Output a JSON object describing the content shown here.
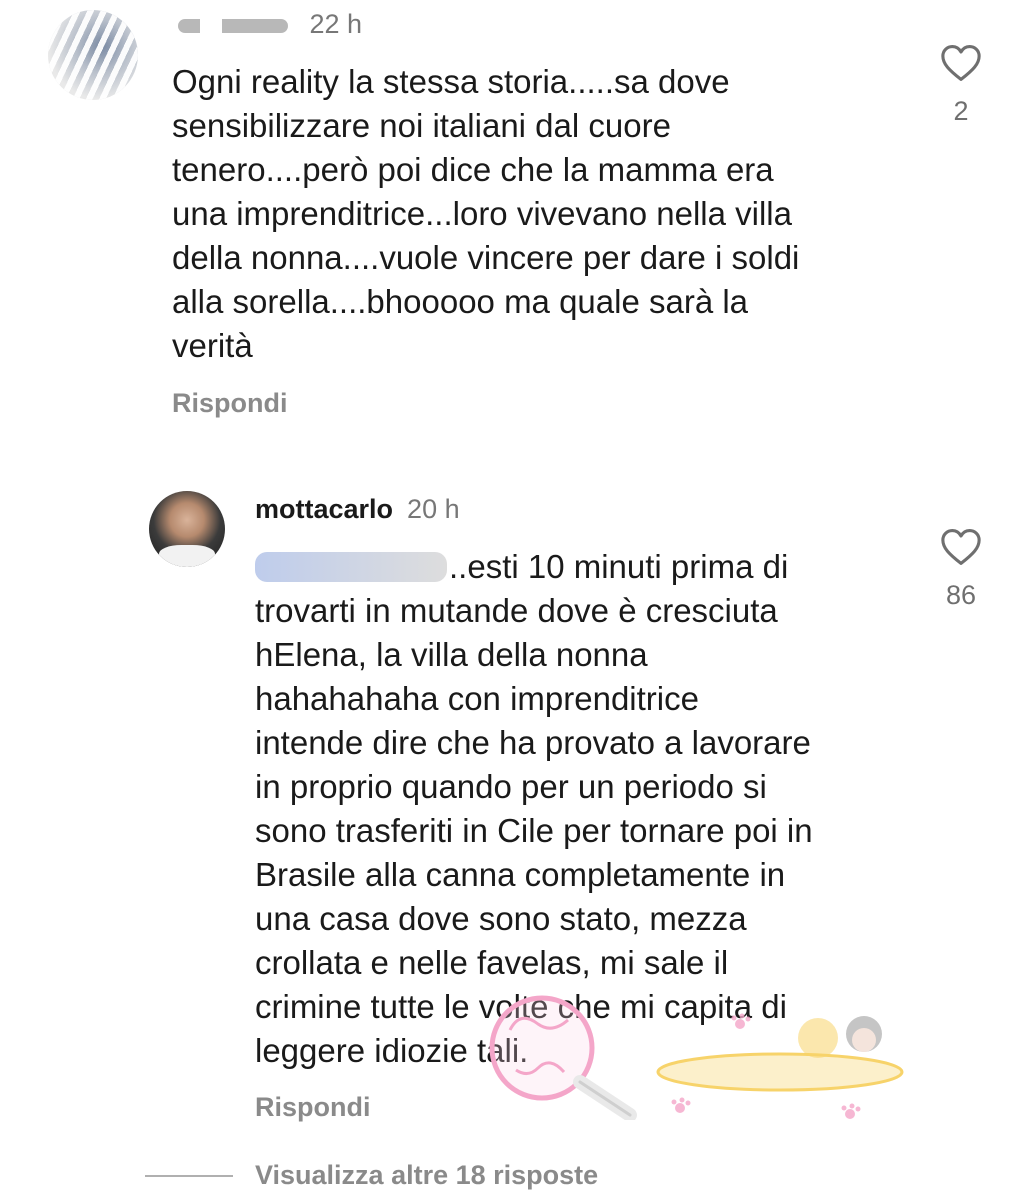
{
  "comments": [
    {
      "username": "",
      "time": "22 h",
      "text": "Ogni reality la stessa storia.....sa dove\nsensibilizzare noi italiani dal cuore\ntenero....però poi dice che la mamma era\nuna imprenditrice...loro vivevano nella villa\ndella nonna....vuole vincere per dare i soldi\nalla sorella....bhooooo ma quale sarà la\nverità",
      "reply_label": "Rispondi",
      "likes": "2"
    },
    {
      "username": "mottacarlo",
      "time": "20 h",
      "mention_tail": "..esti 10 minuti prima di",
      "text": "trovarti in mutande dove è cresciuta\nhElena, la villa della nonna\nhahahahaha con imprenditrice\nintende dire che ha provato a lavorare\nin proprio quando per un periodo si\nsono trasferiti in Cile per tornare poi in\nBrasile alla canna completamente in\nuna casa dove sono stato, mezza\ncrollata e nelle favelas, mi sale il\ncrimine tutte le volte che mi capita di\nleggere idiozie tali.",
      "reply_label": "Rispondi",
      "likes": "86"
    }
  ],
  "view_more_label": "Visualizza altre 18 risposte",
  "icons": {
    "like": "heart-outline-icon"
  },
  "colors": {
    "text": "#1a1a1a",
    "secondary": "#8a8a8a",
    "watermark_pink": "#f4a6c9",
    "watermark_yellow": "#f7d36a"
  }
}
